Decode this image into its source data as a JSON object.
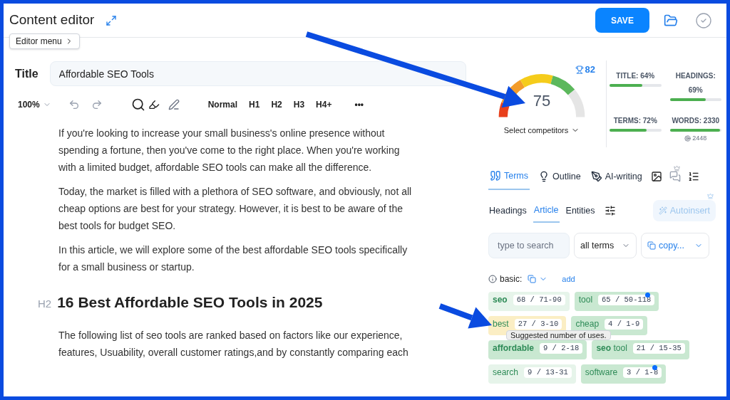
{
  "header": {
    "title": "Content editor",
    "editor_menu": "Editor menu",
    "save": "SAVE"
  },
  "title_field": {
    "label": "Title",
    "value": "Affordable SEO Tools"
  },
  "toolbar": {
    "zoom": "100%",
    "styles": [
      "Normal",
      "H1",
      "H2",
      "H3",
      "H4+"
    ],
    "more": "•••"
  },
  "article": [
    {
      "kind": "p",
      "text": "If you're looking to increase your small business's online presence without spending a fortune, then you've come to the right place. When you're working with a limited budget, affordable SEO tools can make all the difference."
    },
    {
      "kind": "p",
      "text": "Today, the market is filled with a plethora of SEO software, and obviously, not all cheap options are best for your strategy. However, it is best to be aware of the best tools for budget SEO."
    },
    {
      "kind": "p",
      "text": "In this article, we will explore some of the best affordable SEO tools specifically for a small business or startup."
    },
    {
      "kind": "h2",
      "tag": "H2",
      "text": "16 Best Affordable SEO Tools in 2025"
    },
    {
      "kind": "p",
      "text": "The following list of seo tools are ranked based on factors like our experience, features, Usuability, overall customer ratings,and by constantly comparing each"
    }
  ],
  "score": {
    "value": "75",
    "target": "82",
    "competitors": "Select competitors"
  },
  "metrics": [
    {
      "label": "TITLE: 64%",
      "level": 0.64
    },
    {
      "label": "HEADINGS: 69%",
      "level": 0.69
    },
    {
      "label": "TERMS: 72%",
      "level": 0.72
    },
    {
      "label": "WORDS: 2330",
      "level": 0.97,
      "note": "2448"
    }
  ],
  "tabs": [
    {
      "label": "Terms",
      "selected": true
    },
    {
      "label": "Outline",
      "selected": false
    },
    {
      "label": "AI-writing",
      "selected": false
    }
  ],
  "subtabs": [
    {
      "label": "Headings",
      "selected": false
    },
    {
      "label": "Article",
      "selected": true
    },
    {
      "label": "Entities",
      "selected": false
    }
  ],
  "autoinsert": "Autoinsert",
  "filters": {
    "search_placeholder": "type to search",
    "terms_select": "all terms",
    "copy": "copy..."
  },
  "basic": {
    "label": "basic:",
    "add": "add"
  },
  "chips": [
    {
      "term": "**seo**",
      "count": "68 / 71-90",
      "color": "#e6f4ea",
      "flagged": false
    },
    {
      "term": "tool",
      "count": "65 / 50-118",
      "color": "#c9e8d1",
      "flagged": true
    },
    {
      "term": "best",
      "count": "27 / 3-10",
      "color": "#fbeec4",
      "flagged": false
    },
    {
      "term": "cheap",
      "count": "4 / 1-9",
      "color": "#c9e8d1",
      "flagged": false
    },
    {
      "term": "**affordable**",
      "count": "9 / 2-18",
      "color": "#c9e8d1",
      "flagged": false
    },
    {
      "term": "**seo** tool",
      "count": "21 / 15-35",
      "color": "#c9e8d1",
      "flagged": false
    },
    {
      "term": "search",
      "count": "9 / 13-31",
      "color": "#e6f4ea",
      "flagged": false
    },
    {
      "term": "software",
      "count": "3 / 1-8",
      "color": "#c9e8d1",
      "flagged": true
    }
  ],
  "tooltip": "Suggested number of uses."
}
